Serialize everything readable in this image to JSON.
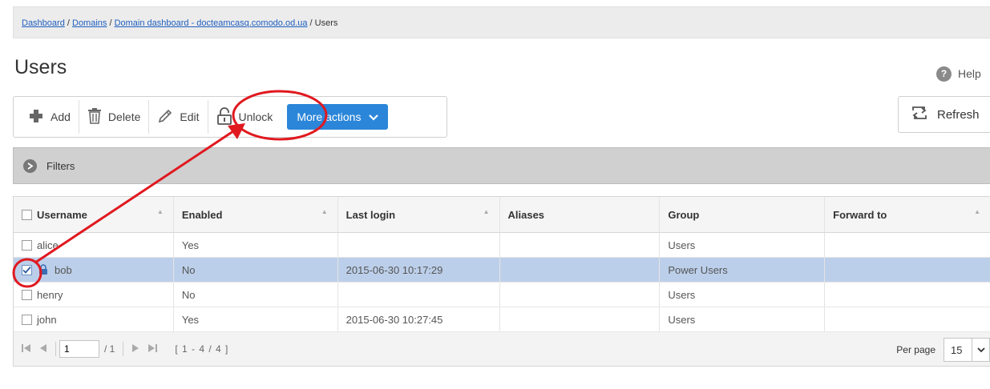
{
  "breadcrumb": {
    "items": [
      "Dashboard",
      "Domains",
      "Domain dashboard - docteamcasq.comodo.od.ua"
    ],
    "separator": " / ",
    "current": "Users"
  },
  "page": {
    "title": "Users"
  },
  "help": {
    "label": "Help",
    "icon": "question-icon"
  },
  "toolbar": {
    "add_label": "Add",
    "delete_label": "Delete",
    "edit_label": "Edit",
    "unlock_label": "Unlock",
    "more_actions_label": "More actions"
  },
  "refresh": {
    "label": "Refresh"
  },
  "filters": {
    "label": "Filters"
  },
  "table": {
    "columns": [
      "Username",
      "Enabled",
      "Last login",
      "Aliases",
      "Group",
      "Forward to"
    ],
    "rows": [
      {
        "username": "alice",
        "enabled": "Yes",
        "last_login": "",
        "aliases": "",
        "group": "Users",
        "forward_to": "",
        "checked": false,
        "locked": false
      },
      {
        "username": "bob",
        "enabled": "No",
        "last_login": "2015-06-30 10:17:29",
        "aliases": "",
        "group": "Power Users",
        "forward_to": "",
        "checked": true,
        "locked": true
      },
      {
        "username": "henry",
        "enabled": "No",
        "last_login": "",
        "aliases": "",
        "group": "Users",
        "forward_to": "",
        "checked": false,
        "locked": false
      },
      {
        "username": "john",
        "enabled": "Yes",
        "last_login": "2015-06-30 10:27:45",
        "aliases": "",
        "group": "Users",
        "forward_to": "",
        "checked": false,
        "locked": false
      }
    ]
  },
  "pager": {
    "page_value": "1",
    "total_pages": "/ 1",
    "range": "[ 1 - 4 / 4 ]",
    "per_page_label": "Per page",
    "per_page_value": "15"
  },
  "colors": {
    "accent": "#2b86d9",
    "selected_row": "#bccfea",
    "annotation": "#e0191f",
    "link": "#1f5fbf"
  }
}
